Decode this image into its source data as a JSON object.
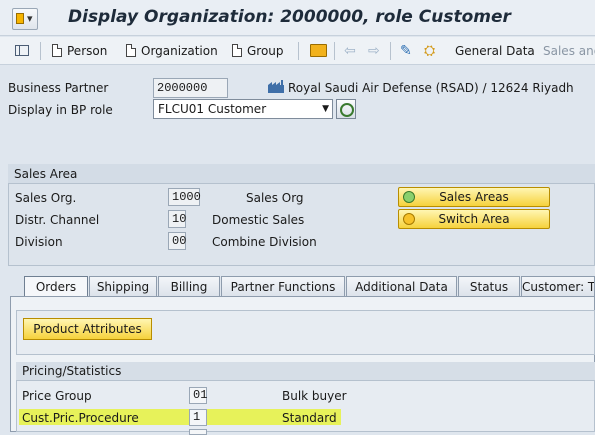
{
  "window": {
    "title": "Display Organization: 2000000, role Customer"
  },
  "toolbar": {
    "person_label": "Person",
    "organization_label": "Organization",
    "group_label": "Group",
    "general_data_label": "General Data",
    "sales_and_label": "Sales and"
  },
  "header": {
    "business_partner_label": "Business Partner",
    "business_partner_value": "2000000",
    "partner_description": "Royal Saudi Air Defense (RSAD) / 12624 Riyadh",
    "display_role_label": "Display in BP role",
    "display_role_value": "FLCU01 Customer"
  },
  "sales_area": {
    "title": "Sales Area",
    "rows": [
      {
        "label": "Sales Org.",
        "value": "1000",
        "description": "Sales Org"
      },
      {
        "label": "Distr. Channel",
        "value": "10",
        "description": "Domestic Sales"
      },
      {
        "label": "Division",
        "value": "00",
        "description": "Combine Division"
      }
    ],
    "sales_areas_button": "Sales Areas",
    "switch_area_button": "Switch Area"
  },
  "tabs": [
    "Orders",
    "Shipping",
    "Billing",
    "Partner Functions",
    "Additional Data",
    "Status",
    "Customer: T"
  ],
  "orders": {
    "product_attributes_button": "Product Attributes",
    "pricing_title": "Pricing/Statistics",
    "rows": [
      {
        "label": "Price Group",
        "value": "01",
        "description": "Bulk buyer"
      },
      {
        "label": "Cust.Pric.Procedure",
        "value": "1",
        "description": "Standard"
      }
    ]
  },
  "colors": {
    "highlight": "#e7f25a",
    "button_yellow": "#f6d23c",
    "background": "#dfe6ee"
  }
}
